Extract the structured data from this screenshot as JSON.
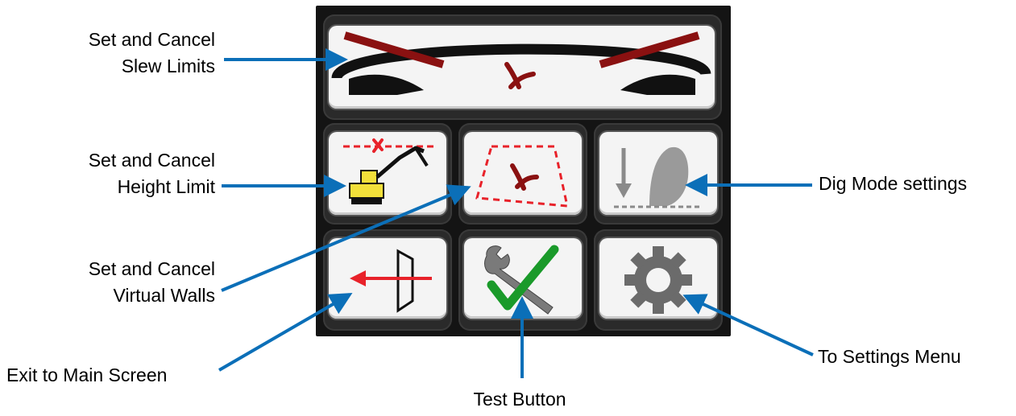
{
  "labels": {
    "slew": [
      "Set and Cancel",
      "Slew Limits"
    ],
    "height": [
      "Set and Cancel",
      "Height Limit"
    ],
    "walls": [
      "Set and Cancel",
      "Virtual Walls"
    ],
    "exit": "Exit to Main Screen",
    "dig": "Dig Mode settings",
    "settings": "To Settings Menu",
    "test": "Test Button"
  },
  "colors": {
    "callout_arrow": "#0b6fb8",
    "limit_red": "#8a1111",
    "dash_red": "#e8222a",
    "excavator_yellow": "#f2e03a",
    "check_green": "#1a9a2a",
    "gear_gray": "#6b6b6b"
  },
  "icons": {
    "slew": "slew-limit-icon",
    "height": "height-limit-icon",
    "walls": "virtual-walls-icon",
    "dig": "dig-mode-icon",
    "exit": "exit-arrow-icon",
    "test": "wrench-check-icon",
    "settings": "gear-icon"
  }
}
